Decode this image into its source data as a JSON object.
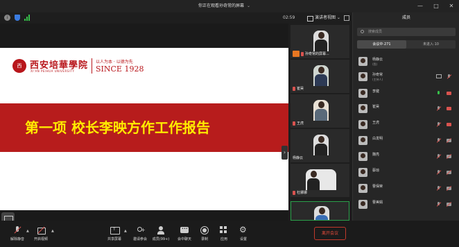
{
  "window": {
    "sharing_notice": "你正在观看孙奇常的屏幕",
    "minimize": "—",
    "maximize": "□",
    "close": "✕"
  },
  "infobar": {
    "timer": "02:59",
    "view_label": "演讲者视图"
  },
  "slide": {
    "logo_seal": "西",
    "logo_cn": "西安培華學院",
    "logo_en": "XI'AN PEIHUA UNIVERSITY",
    "motto": "以人为本 · 以德为先",
    "since": "SINCE 1928",
    "headline": "第一项  校长李映方作工作报告"
  },
  "strip": {
    "tiles": [
      {
        "name": "孙奇常的屏幕..."
      },
      {
        "name": "崔昊"
      },
      {
        "name": "王虎"
      },
      {
        "name": "杨静云"
      },
      {
        "name": "杜娜娜"
      }
    ]
  },
  "panel": {
    "title": "成员",
    "search_placeholder": "搜索成员",
    "tab_in_meeting": "会议中·271",
    "tab_not_joined": "未进入·10",
    "members": [
      {
        "name": "杨静云",
        "role": "(我)"
      },
      {
        "name": "孙奇常",
        "role": "(主持人)"
      },
      {
        "name": "李键",
        "role": ""
      },
      {
        "name": "崔昊",
        "role": ""
      },
      {
        "name": "王虎",
        "role": ""
      },
      {
        "name": "白发明",
        "role": ""
      },
      {
        "name": "魏亮",
        "role": ""
      },
      {
        "name": "蔡琼",
        "role": ""
      },
      {
        "name": "曹保荣",
        "role": ""
      },
      {
        "name": "曹美娟",
        "role": ""
      }
    ]
  },
  "toolbar": {
    "unmute": "解除静音",
    "start_video": "开启视频",
    "share_screen": "共享屏幕",
    "invite": "邀请参会",
    "members": "成员(99+)",
    "chat": "会中聊天",
    "record": "录制",
    "apps": "应用",
    "settings": "设置",
    "leave": "离开会议"
  }
}
